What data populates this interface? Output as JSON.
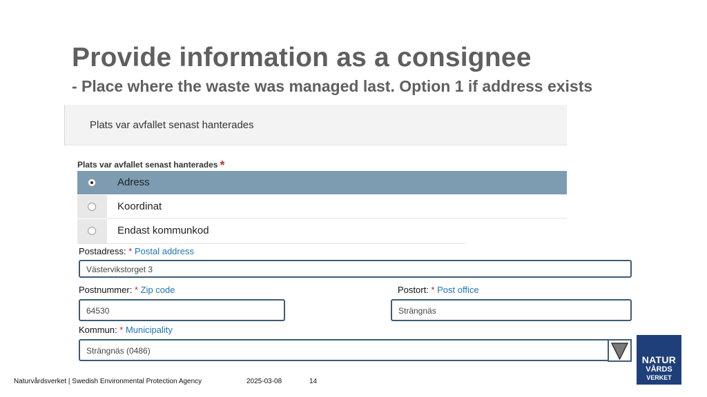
{
  "slide": {
    "title": "Provide information as a consignee",
    "subtitle": "- Place where the waste was managed last. Option 1 if address exists"
  },
  "panel": {
    "header": "Plats var avfallet senast hanterades",
    "field_label": "Plats var avfallet senast hanterades",
    "required_mark": "*",
    "options": [
      {
        "label": "Adress",
        "selected": true
      },
      {
        "label": "Koordinat",
        "selected": false
      },
      {
        "label": "Endast kommunkod",
        "selected": false
      }
    ]
  },
  "form": {
    "postal_address": {
      "label": "Postadress:",
      "star": "*",
      "en": "Postal address",
      "value": "Västervikstorget 3"
    },
    "zip_code": {
      "label": "Postnummer:",
      "star": "*",
      "en": "Zip code",
      "value": "64530"
    },
    "post_office": {
      "label": "Postort:",
      "star": "*",
      "en": "Post office",
      "value": "Strängnäs"
    },
    "municipality": {
      "label": "Kommun:",
      "star": "*",
      "en": "Municipality",
      "value": "Strängnäs (0486)"
    }
  },
  "logo": {
    "line1": "NATUR",
    "line2": "VÅRDS",
    "line3": "VERKET"
  },
  "footer": {
    "org": "Naturvårdsverket | Swedish Environmental Protection Agency",
    "date": "2025-03-08",
    "page": "14"
  },
  "colors": {
    "title": "#5f5f5f",
    "selected_row": "#7d9cb1",
    "field_border": "#3d5a75",
    "required": "#d01f1f",
    "english_label": "#1f74b4",
    "logo_bg": "#1e3f7a"
  },
  "icons": {
    "dropdown": "triangle-down-icon",
    "radio": "radio-icon"
  }
}
